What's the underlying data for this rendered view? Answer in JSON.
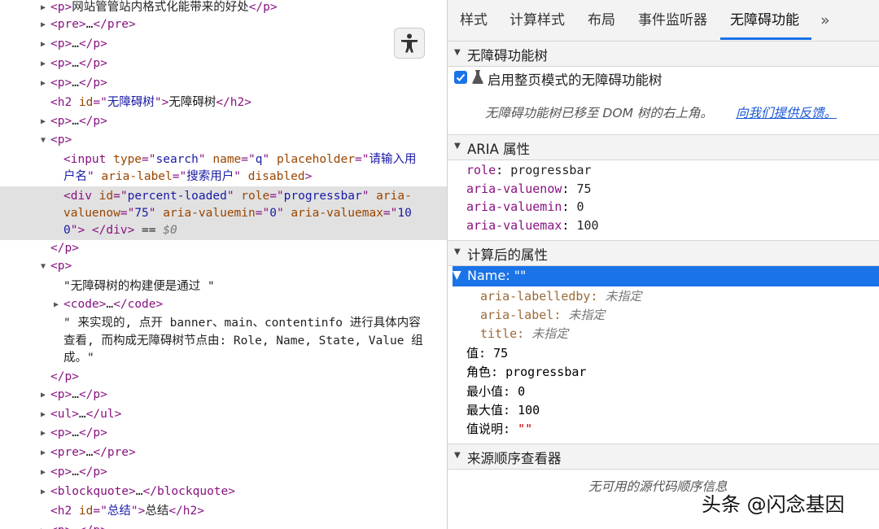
{
  "dom_tree": {
    "rows": [
      {
        "tri": "▶",
        "parts": [
          [
            "tag",
            "<p>"
          ],
          [
            "txt",
            "网站管管站内格式化能带来的好处"
          ],
          [
            "tag",
            "</p>"
          ]
        ]
      },
      {
        "tri": "▶",
        "parts": [
          [
            "tag",
            "<pre>"
          ],
          [
            "txt",
            "…"
          ],
          [
            "tag",
            "</pre>"
          ]
        ]
      },
      {
        "tri": "▶",
        "parts": [
          [
            "tag",
            "<p>"
          ],
          [
            "txt",
            "…"
          ],
          [
            "tag",
            "</p>"
          ]
        ]
      },
      {
        "tri": "▶",
        "parts": [
          [
            "tag",
            "<p>"
          ],
          [
            "txt",
            "…"
          ],
          [
            "tag",
            "</p>"
          ]
        ]
      },
      {
        "tri": "▶",
        "parts": [
          [
            "tag",
            "<p>"
          ],
          [
            "txt",
            "…"
          ],
          [
            "tag",
            "</p>"
          ]
        ]
      },
      {
        "tri": "",
        "parts": [
          [
            "tag",
            "<h2 "
          ],
          [
            "attr",
            "id"
          ],
          [
            "tag",
            "=\""
          ],
          [
            "val",
            "无障碍树"
          ],
          [
            "tag",
            "\">"
          ],
          [
            "txt",
            "无障碍树"
          ],
          [
            "tag",
            "</h2>"
          ]
        ]
      },
      {
        "tri": "▶",
        "parts": [
          [
            "tag",
            "<p>"
          ],
          [
            "txt",
            "…"
          ],
          [
            "tag",
            "</p>"
          ]
        ]
      },
      {
        "tri": "▼",
        "parts": [
          [
            "tag",
            "<p>"
          ]
        ]
      },
      {
        "tri": "",
        "parts": [
          [
            "tag",
            "<input "
          ],
          [
            "attr",
            "type"
          ],
          [
            "tag",
            "=\""
          ],
          [
            "val",
            "search"
          ],
          [
            "tag",
            "\" "
          ],
          [
            "attr",
            "name"
          ],
          [
            "tag",
            "=\""
          ],
          [
            "val",
            "q"
          ],
          [
            "tag",
            "\" "
          ],
          [
            "attr",
            "placeholder"
          ],
          [
            "tag",
            "=\""
          ],
          [
            "val",
            "请输入用"
          ]
        ]
      },
      {
        "tri": "",
        "parts": [
          [
            "val",
            "户名"
          ],
          [
            "tag",
            "\" "
          ],
          [
            "attr",
            "aria-label"
          ],
          [
            "tag",
            "=\""
          ],
          [
            "val",
            "搜索用户"
          ],
          [
            "tag",
            "\" "
          ],
          [
            "attr",
            "disabled"
          ],
          [
            "tag",
            ">"
          ]
        ]
      },
      {
        "tri": "",
        "parts": [
          [
            "tag",
            "<div "
          ],
          [
            "attr",
            "id"
          ],
          [
            "tag",
            "=\""
          ],
          [
            "val",
            "percent-loaded"
          ],
          [
            "tag",
            "\" "
          ],
          [
            "attr",
            "role"
          ],
          [
            "tag",
            "=\""
          ],
          [
            "val",
            "progressbar"
          ],
          [
            "tag",
            "\" "
          ],
          [
            "attr",
            "aria-"
          ]
        ]
      },
      {
        "tri": "",
        "parts": [
          [
            "attr",
            "valuenow"
          ],
          [
            "tag",
            "=\""
          ],
          [
            "val",
            "75"
          ],
          [
            "tag",
            "\" "
          ],
          [
            "attr",
            "aria-valuemin"
          ],
          [
            "tag",
            "=\""
          ],
          [
            "val",
            "0"
          ],
          [
            "tag",
            "\" "
          ],
          [
            "attr",
            "aria-valuemax"
          ],
          [
            "tag",
            "=\""
          ],
          [
            "val",
            "10"
          ]
        ]
      },
      {
        "tri": "",
        "parts": [
          [
            "val",
            "0"
          ],
          [
            "tag",
            "\"> </div>"
          ],
          [
            "txt",
            " == "
          ],
          [
            "dim",
            "$0"
          ]
        ]
      },
      {
        "tri": "",
        "parts": [
          [
            "tag",
            "</p>"
          ]
        ]
      },
      {
        "tri": "▼",
        "parts": [
          [
            "tag",
            "<p>"
          ]
        ]
      },
      {
        "tri": "",
        "parts": [
          [
            "txt",
            "\"无障碍树的构建便是通过 \""
          ]
        ]
      },
      {
        "tri": "▶",
        "parts": [
          [
            "tag",
            "<code>"
          ],
          [
            "txt",
            "…"
          ],
          [
            "tag",
            "</code>"
          ]
        ]
      },
      {
        "tri": "",
        "parts": [
          [
            "txt",
            "\" 来实现的, 点开 banner、main、contentinfo 进行具体内容"
          ]
        ]
      },
      {
        "tri": "",
        "parts": [
          [
            "txt",
            "查看, 而构成无障碍树节点由: Role, Name, State, Value 组"
          ]
        ]
      },
      {
        "tri": "",
        "parts": [
          [
            "txt",
            "成。\""
          ]
        ]
      },
      {
        "tri": "",
        "parts": [
          [
            "tag",
            "</p>"
          ]
        ]
      },
      {
        "tri": "▶",
        "parts": [
          [
            "tag",
            "<p>"
          ],
          [
            "txt",
            "…"
          ],
          [
            "tag",
            "</p>"
          ]
        ]
      },
      {
        "tri": "▶",
        "parts": [
          [
            "tag",
            "<ul>"
          ],
          [
            "txt",
            "…"
          ],
          [
            "tag",
            "</ul>"
          ]
        ]
      },
      {
        "tri": "▶",
        "parts": [
          [
            "tag",
            "<p>"
          ],
          [
            "txt",
            "…"
          ],
          [
            "tag",
            "</p>"
          ]
        ]
      },
      {
        "tri": "▶",
        "parts": [
          [
            "tag",
            "<pre>"
          ],
          [
            "txt",
            "…"
          ],
          [
            "tag",
            "</pre>"
          ]
        ]
      },
      {
        "tri": "▶",
        "parts": [
          [
            "tag",
            "<p>"
          ],
          [
            "txt",
            "…"
          ],
          [
            "tag",
            "</p>"
          ]
        ]
      },
      {
        "tri": "▶",
        "parts": [
          [
            "tag",
            "<blockquote>"
          ],
          [
            "txt",
            "…"
          ],
          [
            "tag",
            "</blockquote>"
          ]
        ]
      },
      {
        "tri": "",
        "parts": [
          [
            "tag",
            "<h2 "
          ],
          [
            "attr",
            "id"
          ],
          [
            "tag",
            "=\""
          ],
          [
            "val",
            "总结"
          ],
          [
            "tag",
            "\">"
          ],
          [
            "txt",
            "总结"
          ],
          [
            "tag",
            "</h2>"
          ]
        ]
      },
      {
        "tri": "▶",
        "parts": [
          [
            "tag",
            "<p>"
          ],
          [
            "txt",
            "…"
          ],
          [
            "tag",
            "</p>"
          ]
        ]
      }
    ]
  },
  "tabs": [
    "样式",
    "计算样式",
    "布局",
    "事件监听器",
    "无障碍功能",
    "»"
  ],
  "active_tab": "无障碍功能",
  "sections": {
    "tree": {
      "title": "无障碍功能树",
      "checkbox_label": "启用整页模式的无障碍功能树",
      "moved_note": "无障碍功能树已移至 DOM 树的右上角。",
      "feedback_link": "向我们提供反馈。"
    },
    "aria": {
      "title": "ARIA 属性",
      "props": [
        {
          "key": "role",
          "value": "progressbar"
        },
        {
          "key": "aria-valuenow",
          "value": "75"
        },
        {
          "key": "aria-valuemin",
          "value": "0"
        },
        {
          "key": "aria-valuemax",
          "value": "100"
        }
      ]
    },
    "computed": {
      "title": "计算后的属性",
      "name_label": "Name: \"\"",
      "name_sources": [
        {
          "key": "aria-labelledby",
          "value": "未指定"
        },
        {
          "key": "aria-label",
          "value": "未指定"
        },
        {
          "key": "title",
          "value": "未指定"
        }
      ],
      "props": [
        {
          "key": "值",
          "value": "75"
        },
        {
          "key": "角色",
          "value": "progressbar"
        },
        {
          "key": "最小值",
          "value": "0"
        },
        {
          "key": "最大值",
          "value": "100"
        },
        {
          "key": "值说明",
          "value": "\"\""
        }
      ]
    },
    "source_order": {
      "title": "来源顺序查看器",
      "empty_note": "无可用的源代码顺序信息"
    }
  },
  "watermark": "头条 @闪念基因",
  "colors": {
    "accent": "#1a73e8",
    "tag": "#881280",
    "attr": "#994500",
    "value": "#1a1aa6"
  },
  "icons": {
    "accessibility_toggle": "accessibility-person-icon",
    "experiment": "flask-icon"
  }
}
